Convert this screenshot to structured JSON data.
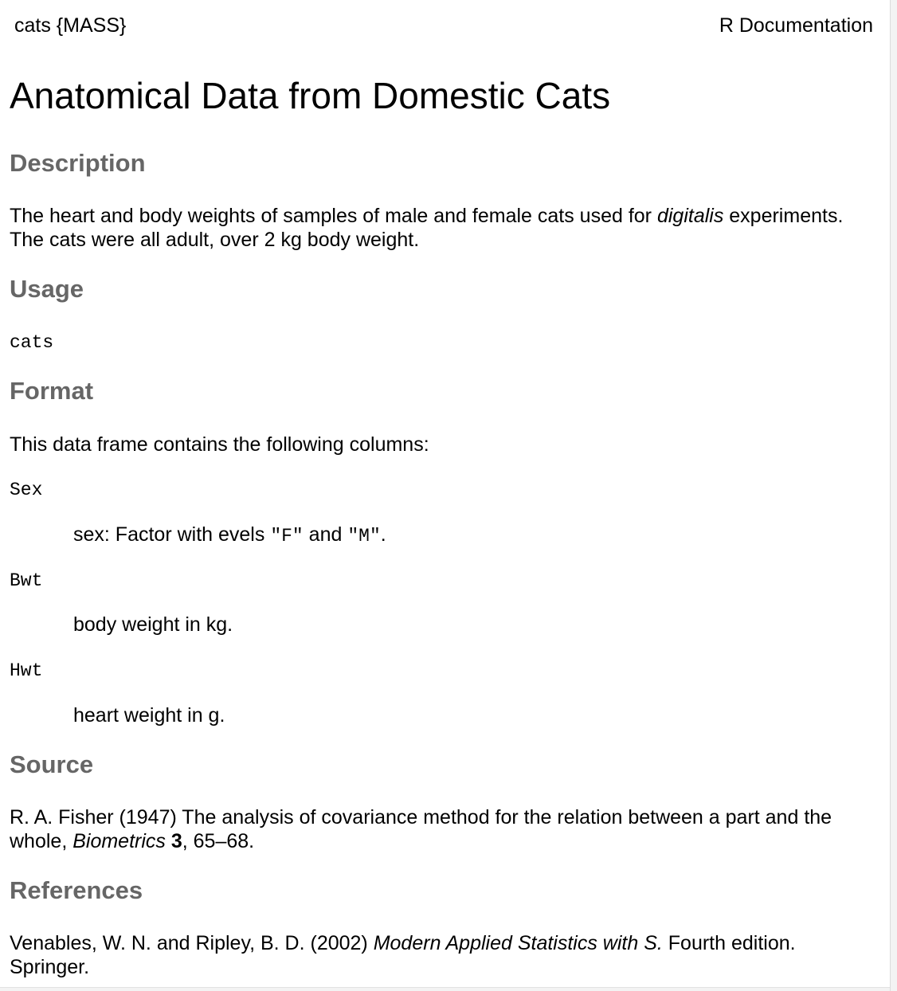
{
  "header": {
    "topic": "cats {MASS}",
    "doc_type": "R Documentation"
  },
  "title": "Anatomical Data from Domestic Cats",
  "description": {
    "heading": "Description",
    "text_before": "The heart and body weights of samples of male and female cats used for ",
    "text_italic": "digitalis",
    "text_after": " experiments.",
    "line2": "The cats were all adult, over 2 kg body weight."
  },
  "usage": {
    "heading": "Usage",
    "code": "cats"
  },
  "format": {
    "heading": "Format",
    "intro": "This data frame contains the following columns:",
    "columns": [
      {
        "name": "Sex",
        "desc_before": "sex: Factor with evels ",
        "level1": "\"F\"",
        "desc_mid": " and ",
        "level2": "\"M\"",
        "desc_after": "."
      },
      {
        "name": "Bwt",
        "desc": "body weight in kg."
      },
      {
        "name": "Hwt",
        "desc": "heart weight in g."
      }
    ]
  },
  "source": {
    "heading": "Source",
    "line1": "R. A. Fisher (1947) The analysis of covariance method for the relation between a part and the",
    "line2_prefix": "whole, ",
    "journal": "Biometrics",
    "volume": "3",
    "pages": ", 65–68."
  },
  "references": {
    "heading": "References",
    "authors": "Venables, W. N. and Ripley, B. D. (2002) ",
    "book": "Modern Applied Statistics with S.",
    "edition": " Fourth edition.",
    "publisher": "Springer."
  }
}
